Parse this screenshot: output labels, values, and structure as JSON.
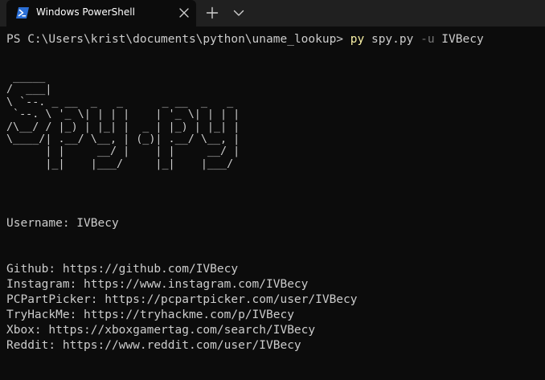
{
  "window": {
    "tab_title": "Windows PowerShell",
    "icons": {
      "tab": "powershell-icon",
      "close": "close-icon",
      "new_tab": "plus-icon",
      "dropdown": "chevron-down-icon"
    }
  },
  "prompt": {
    "path": "PS C:\\Users\\krist\\documents\\python\\uname_lookup>",
    "command": "py",
    "script": "spy.py",
    "flag": "-u",
    "value": "IVBecy"
  },
  "banner": " _____\n/  ___|\n\\ `--. _ __  _   _      _ __  _   _\n `--. \\ '_ \\| | | |    | '_ \\| | | |\n/\\__/ / |_) | |_| |  _ | |_) | |_| |\n\\____/| .__/ \\__, | (_)| .__/ \\__, |\n      | |     __/ |    | |     __/ |\n      |_|    |___/     |_|    |___/",
  "username_line": "Username: IVBecy",
  "results": [
    "Github: https://github.com/IVBecy",
    "Instagram: https://www.instagram.com/IVBecy",
    "PCPartPicker: https://pcpartpicker.com/user/IVBecy",
    "TryHackMe: https://tryhackme.com/p/IVBecy",
    "Xbox: https://xboxgamertag.com/search/IVBecy",
    "Reddit: https://www.reddit.com/user/IVBecy"
  ],
  "colors": {
    "background": "#0c0c0c",
    "tabbar": "#202020",
    "text": "#cccccc",
    "command": "#f9f1a5",
    "flag": "#767676"
  }
}
